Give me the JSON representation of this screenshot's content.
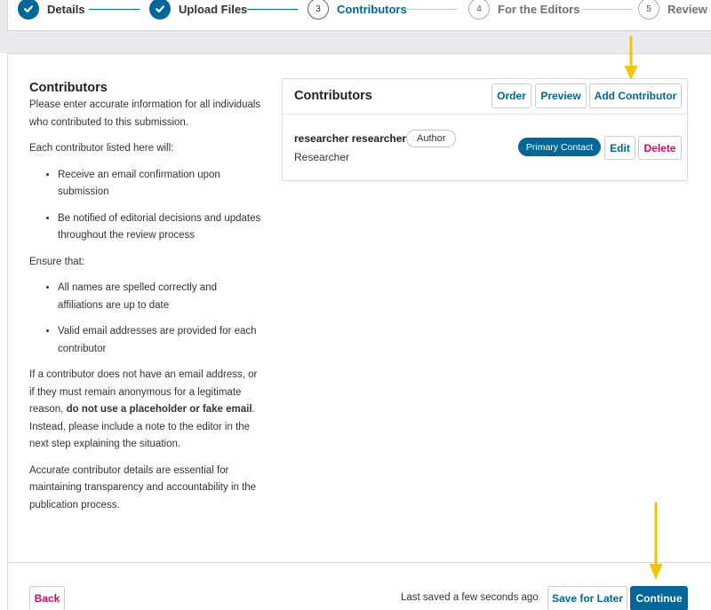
{
  "stepper": {
    "steps": [
      {
        "number": "1",
        "label": "Details",
        "state": "done"
      },
      {
        "number": "2",
        "label": "Upload Files",
        "state": "done"
      },
      {
        "number": "3",
        "label": "Contributors",
        "state": "current"
      },
      {
        "number": "4",
        "label": "For the Editors",
        "state": "todo"
      },
      {
        "number": "5",
        "label": "Review",
        "state": "todo"
      }
    ],
    "done_icon": "check-icon"
  },
  "help": {
    "title": "Contributors",
    "intro": "Please enter accurate information for all individuals who contributed to this submission.",
    "each_label": "Each contributor listed here will:",
    "each_items": [
      "Receive an email confirmation upon submission",
      "Be notified of editorial decisions and updates throughout the review process"
    ],
    "ensure_label": "Ensure that:",
    "ensure_items": [
      "All names are spelled correctly and affiliations are up to date",
      "Valid email addresses are provided for each contributor"
    ],
    "warning_pre": "If a contributor does not have an email address, or if they must remain anonymous for a legitimate reason, ",
    "warning_bold": "do not use a placeholder or fake email",
    "warning_post": ". Instead, please include a note to the editor in the next step explaining the situation.",
    "closing": "Accurate contributor details are essential for maintaining transparency and accountability in the publication process."
  },
  "panel": {
    "title": "Contributors",
    "order_label": "Order",
    "preview_label": "Preview",
    "add_label": "Add Contributor",
    "contributors": [
      {
        "name": "researcher researcher",
        "role": "Author",
        "affiliation": "Researcher",
        "primary_label": "Primary Contact",
        "edit_label": "Edit",
        "delete_label": "Delete"
      }
    ]
  },
  "footer": {
    "back_label": "Back",
    "saved_text": "Last saved a few seconds ago",
    "save_later_label": "Save for Later",
    "continue_label": "Continue"
  },
  "colors": {
    "primary": "#006798",
    "danger": "#d00a6c",
    "annotation_arrow": "#f5c400",
    "page_gray": "#e9ebee"
  }
}
